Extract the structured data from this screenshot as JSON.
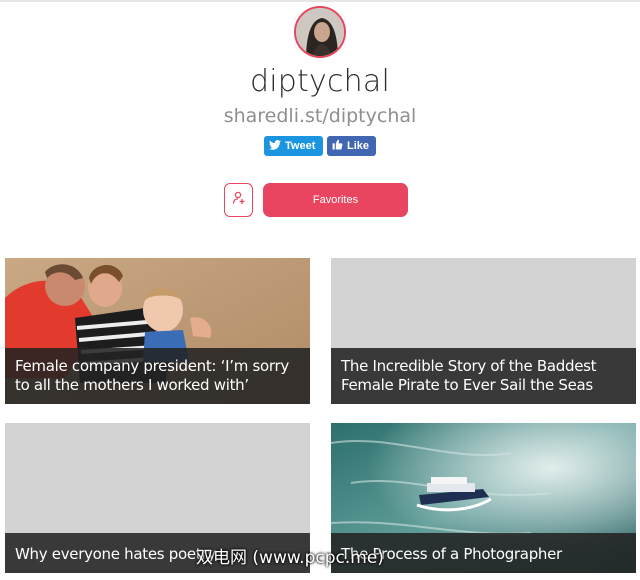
{
  "profile": {
    "username": "diptychal",
    "share_url": "sharedli.st/diptychal",
    "accent_color": "#ea4560"
  },
  "social": {
    "tweet_label": "Tweet",
    "like_label": "Like"
  },
  "actions": {
    "follow_icon": "add-user-icon",
    "favorites_label": "Favorites"
  },
  "cards": [
    {
      "title": "Female company president: ‘I’m sorry to all the mothers I worked with’",
      "image": "family-on-beach-photo"
    },
    {
      "title": "The Incredible Story of the Baddest Female Pirate to Ever Sail the Seas",
      "image": "placeholder-gray"
    },
    {
      "title": "Why everyone hates poetry",
      "image": "placeholder-gray"
    },
    {
      "title": "The Process of a Photographer",
      "image": "boat-in-waterfall-mist-photo"
    }
  ],
  "watermark": "双电网 (www.pcpc.me)"
}
